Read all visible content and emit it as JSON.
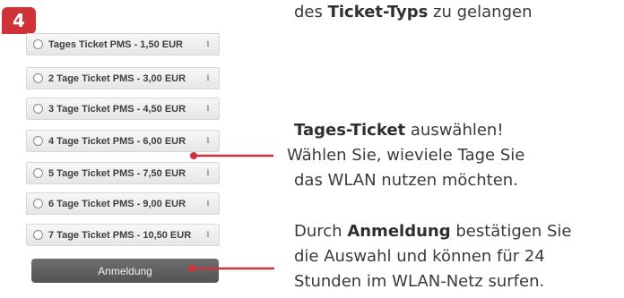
{
  "step_number": "4",
  "ticket_options": [
    {
      "label": "Tages Ticket PMS - 1,50 EUR",
      "info": "i"
    },
    {
      "label": "2 Tage Ticket PMS - 3,00 EUR",
      "info": "i"
    },
    {
      "label": "3 Tage Ticket PMS - 4,50 EUR",
      "info": "i"
    },
    {
      "label": "4 Tage Ticket PMS - 6,00 EUR",
      "info": "i"
    },
    {
      "label": "5 Tage Ticket PMS - 7,50 EUR",
      "info": "i"
    },
    {
      "label": "6 Tage Ticket PMS - 9,00 EUR",
      "info": "i"
    },
    {
      "label": "7 Tage Ticket PMS - 10,50 EUR",
      "info": "i"
    }
  ],
  "submit_button": "Anmeldung",
  "instructions": {
    "top": {
      "pre": "des ",
      "bold": "Ticket-Typs",
      "post": " zu gelangen"
    },
    "middle": {
      "line1_bold": "Tages-Ticket",
      "line1_post": " auswählen!",
      "line2": "Wählen Sie, wieviele Tage Sie",
      "line3": "das WLAN nutzen möchten."
    },
    "bottom": {
      "line1_pre": "Durch ",
      "line1_bold": "Anmeldung",
      "line1_post": " bestätigen Sie",
      "line2": "die Auswahl und können für 24",
      "line3": "Stunden im WLAN-Netz surfen."
    }
  },
  "colors": {
    "accent": "#cf3338",
    "button": "#606060"
  }
}
